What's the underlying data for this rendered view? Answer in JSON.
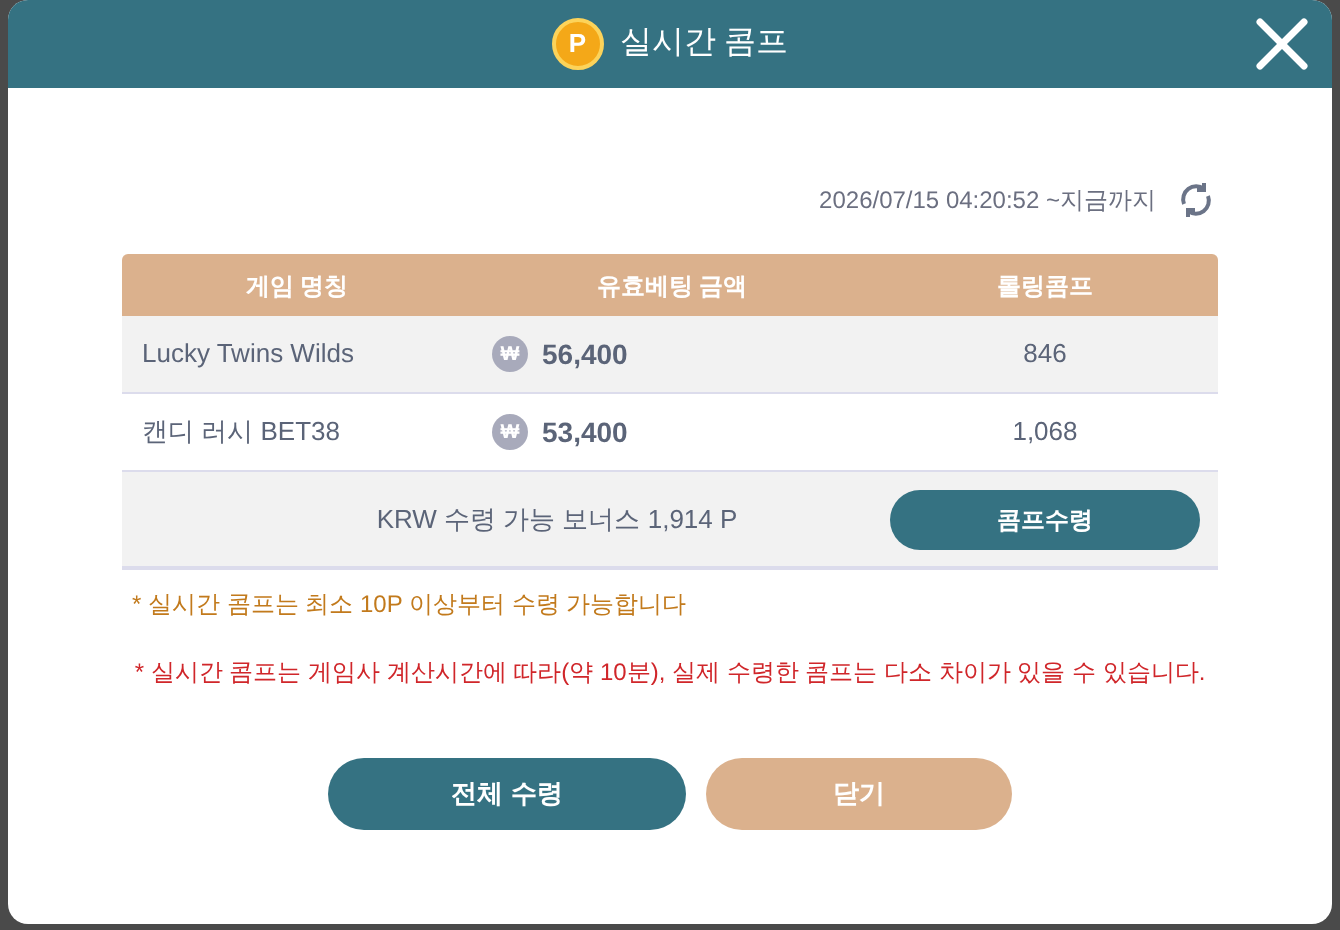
{
  "dialog": {
    "title": "실시간 콤프",
    "coin_label": "P"
  },
  "period": "2026/07/15 04:20:52 ~지금까지",
  "table": {
    "columns": [
      "게임 명칭",
      "유효베팅 금액",
      "롤링콤프"
    ],
    "rows": [
      {
        "game": "Lucky Twins Wilds",
        "currency": "₩",
        "amount": "56,400",
        "comp": "846"
      },
      {
        "game": "캔디 러시 BET38",
        "currency": "₩",
        "amount": "53,400",
        "comp": "1,068"
      }
    ],
    "summary": "KRW 수령 가능 보너스 1,914 P",
    "claim_button": "콤프수령"
  },
  "notes": [
    {
      "kind": "min",
      "text": "* 실시간 콤프는 최소 10P 이상부터 수령 가능합니다"
    },
    {
      "kind": "warning",
      "text": "* 실시간 콤프는 게임사 계산시간에 따라(약 10분), 실제 수령한 콤프는 다소 차이가 있을 수 있습니다."
    }
  ],
  "buttons": [
    {
      "kind": "primary",
      "label": "전체 수령"
    },
    {
      "kind": "secondary",
      "label": "닫기"
    }
  ]
}
